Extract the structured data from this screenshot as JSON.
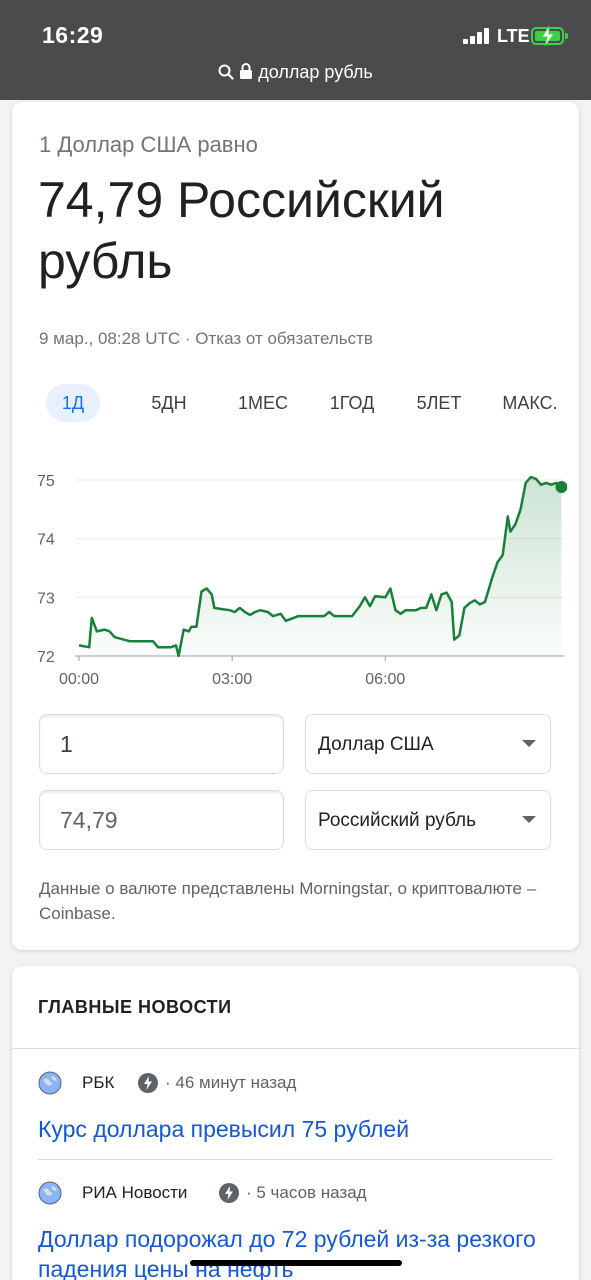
{
  "status_bar": {
    "time": "16:29",
    "network": "LTE",
    "url": "доллар рубль"
  },
  "converter": {
    "equals_label": "1 Доллар США равно",
    "result": "74,79 Российский рубль",
    "timestamp": "9 мар., 08:28 UTC",
    "separator": " · ",
    "disclaimer": "Отказ от обязательств",
    "tabs": [
      "1Д",
      "5ДН",
      "1МЕС",
      "1ГОД",
      "5ЛЕТ",
      "МАКС."
    ],
    "active_tab": "1Д",
    "from_amount": "1",
    "from_currency": "Доллар США",
    "to_amount": "74,79",
    "to_currency": "Российский рубль",
    "source_note": "Данные о валюте представлены Morningstar, о криптовалюте – Coinbase."
  },
  "chart_data": {
    "type": "area",
    "x_tick_labels": [
      "00:00",
      "03:00",
      "06:00"
    ],
    "y_tick_labels": [
      "75",
      "74",
      "73",
      "72"
    ],
    "ylim": [
      72,
      75
    ],
    "x_domain_hours": [
      0,
      8.6
    ],
    "line_color": "#188038",
    "fill_color": "#e6f4ea",
    "points": [
      [
        0.0,
        72.18
      ],
      [
        0.2,
        72.15
      ],
      [
        0.25,
        72.65
      ],
      [
        0.35,
        72.42
      ],
      [
        0.5,
        72.45
      ],
      [
        0.6,
        72.42
      ],
      [
        0.7,
        72.32
      ],
      [
        1.0,
        72.25
      ],
      [
        1.3,
        72.25
      ],
      [
        1.45,
        72.25
      ],
      [
        1.55,
        72.15
      ],
      [
        1.8,
        72.15
      ],
      [
        1.9,
        72.18
      ],
      [
        1.95,
        72.0
      ],
      [
        2.05,
        72.45
      ],
      [
        2.15,
        72.42
      ],
      [
        2.2,
        72.5
      ],
      [
        2.3,
        72.5
      ],
      [
        2.4,
        73.1
      ],
      [
        2.5,
        73.15
      ],
      [
        2.6,
        73.05
      ],
      [
        2.65,
        72.82
      ],
      [
        2.8,
        72.8
      ],
      [
        2.95,
        72.78
      ],
      [
        3.05,
        72.75
      ],
      [
        3.15,
        72.82
      ],
      [
        3.25,
        72.75
      ],
      [
        3.35,
        72.7
      ],
      [
        3.45,
        72.75
      ],
      [
        3.55,
        72.78
      ],
      [
        3.7,
        72.75
      ],
      [
        3.8,
        72.68
      ],
      [
        3.95,
        72.72
      ],
      [
        4.05,
        72.6
      ],
      [
        4.2,
        72.65
      ],
      [
        4.3,
        72.68
      ],
      [
        4.6,
        72.68
      ],
      [
        4.8,
        72.68
      ],
      [
        4.9,
        72.75
      ],
      [
        5.0,
        72.68
      ],
      [
        5.2,
        72.68
      ],
      [
        5.35,
        72.68
      ],
      [
        5.5,
        72.85
      ],
      [
        5.6,
        73.0
      ],
      [
        5.7,
        72.85
      ],
      [
        5.8,
        73.02
      ],
      [
        6.0,
        73.0
      ],
      [
        6.1,
        73.15
      ],
      [
        6.2,
        72.78
      ],
      [
        6.3,
        72.72
      ],
      [
        6.4,
        72.78
      ],
      [
        6.6,
        72.78
      ],
      [
        6.7,
        72.82
      ],
      [
        6.8,
        72.82
      ],
      [
        6.9,
        73.05
      ],
      [
        7.0,
        72.78
      ],
      [
        7.1,
        73.05
      ],
      [
        7.2,
        73.08
      ],
      [
        7.3,
        72.92
      ],
      [
        7.35,
        72.28
      ],
      [
        7.45,
        72.35
      ],
      [
        7.55,
        72.82
      ],
      [
        7.65,
        72.9
      ],
      [
        7.75,
        72.95
      ],
      [
        7.85,
        72.88
      ],
      [
        7.95,
        72.92
      ],
      [
        8.1,
        73.35
      ],
      [
        8.2,
        73.6
      ],
      [
        8.3,
        73.72
      ],
      [
        8.4,
        74.38
      ],
      [
        8.45,
        74.12
      ],
      [
        8.55,
        74.25
      ],
      [
        8.65,
        74.5
      ],
      [
        8.75,
        74.95
      ],
      [
        8.85,
        75.05
      ],
      [
        8.95,
        75.02
      ],
      [
        9.05,
        74.92
      ],
      [
        9.15,
        74.95
      ],
      [
        9.25,
        74.92
      ],
      [
        9.35,
        74.95
      ],
      [
        9.45,
        74.88
      ]
    ]
  },
  "news": {
    "heading": "ГЛАВНЫЕ НОВОСТИ",
    "items": [
      {
        "source": "РБК",
        "time_ago": "· 46 минут назад",
        "title": "Курс доллара превысил 75 рублей"
      },
      {
        "source": "РИА Новости",
        "time_ago": "· 5 часов назад",
        "title": "Доллар подорожал до 72 рублей из-за резкого падения цены на нефть"
      }
    ]
  }
}
